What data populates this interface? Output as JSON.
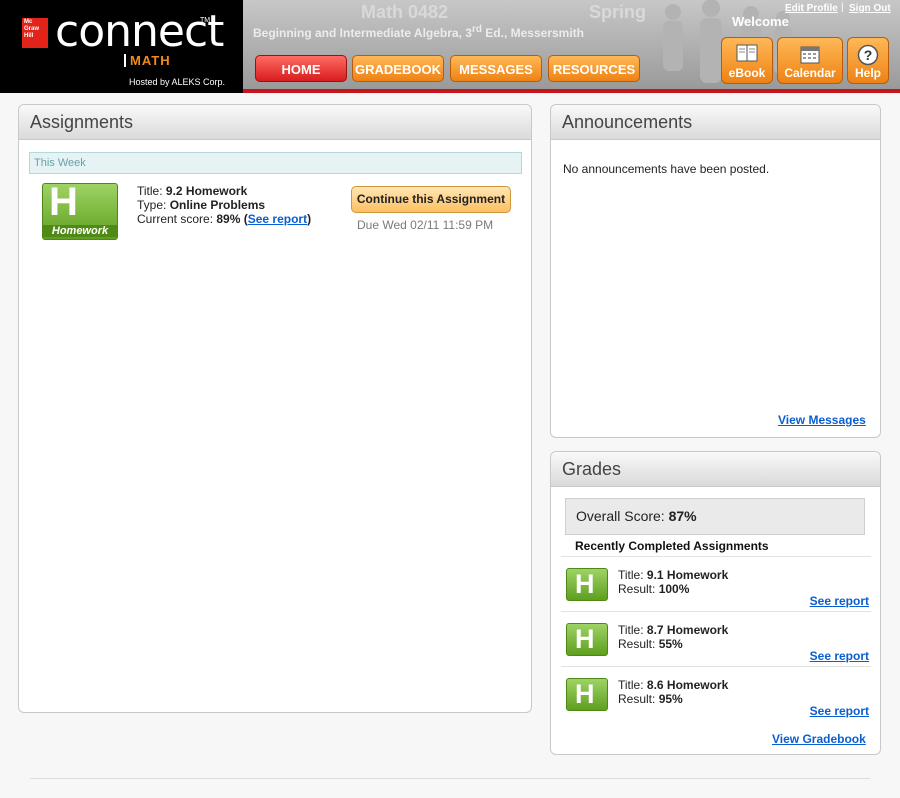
{
  "brand": {
    "publisher_lines": [
      "Mc",
      "Graw",
      "Hill"
    ],
    "logo_word": "connect",
    "trademark": "TM",
    "product": "MATH",
    "hosted_by": "Hosted by ALEKS Corp."
  },
  "course": {
    "title": "Math 0482",
    "term": "Spring",
    "book_prefix": "Beginning and Intermediate Algebra, 3",
    "book_edition_sup": "rd",
    "book_suffix": " Ed., Messersmith"
  },
  "nav": {
    "home": "HOME",
    "gradebook": "GRADEBOOK",
    "messages": "MESSAGES",
    "resources": "RESOURCES"
  },
  "user": {
    "welcome": "Welcome",
    "edit_profile": "Edit Profile",
    "separator": "|",
    "sign_out": "Sign Out"
  },
  "tools": {
    "ebook": "eBook",
    "calendar": "Calendar",
    "help": "Help",
    "icons": [
      "book-icon",
      "calendar-icon",
      "help-icon"
    ]
  },
  "colors": {
    "accent_orange": "#ee8214",
    "home_red": "#d81d1d",
    "brand_red": "#c4161c",
    "link_blue": "#0b5ed1",
    "homework_green": "#5f9f1f"
  },
  "assignments": {
    "heading": "Assignments",
    "section": "This Week",
    "item": {
      "icon_letter": "H",
      "icon_label": "Homework",
      "title_label": "Title: ",
      "title": "9.2 Homework",
      "type_label": "Type: ",
      "type": "Online Problems",
      "score_label": "Current score: ",
      "score": "89%",
      "report_open": " (",
      "report_link": "See report",
      "report_close": ")",
      "continue_label": "Continue this Assignment",
      "due": "Due Wed 02/11 11:59 PM"
    }
  },
  "announcements": {
    "heading": "Announcements",
    "empty_text": "No announcements have been posted.",
    "view_messages": "View Messages"
  },
  "grades": {
    "heading": "Grades",
    "overall_label": "Overall Score: ",
    "overall_value": "87%",
    "recent_title": "Recently Completed Assignments",
    "title_label": "Title: ",
    "result_label": "Result: ",
    "see_report": "See report",
    "items": [
      {
        "icon_letter": "H",
        "title": "9.1 Homework",
        "result": "100%"
      },
      {
        "icon_letter": "H",
        "title": "8.7 Homework",
        "result": "55%"
      },
      {
        "icon_letter": "H",
        "title": "8.6 Homework",
        "result": "95%"
      }
    ],
    "view_gradebook": "View Gradebook"
  }
}
